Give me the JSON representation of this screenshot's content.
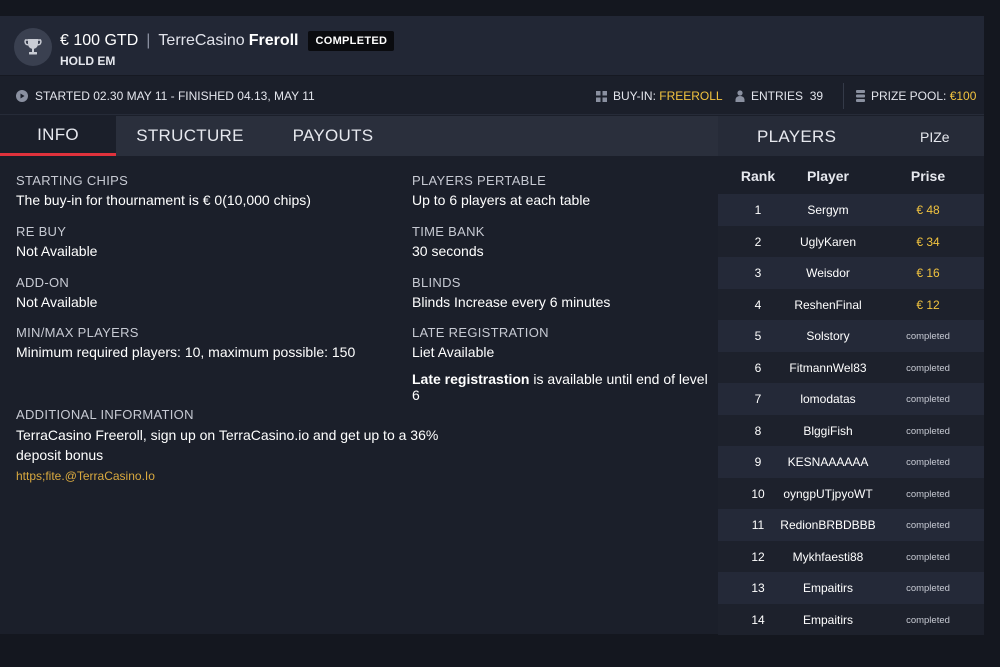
{
  "header": {
    "gtd": "€ 100 GTD",
    "separator": "|",
    "brand": "TerreCasino",
    "name": "Freroll",
    "status": "COMPLETED",
    "game": "HOLD EM"
  },
  "infobar": {
    "started": "STARTED 02.30  MAY 11 - FINISHED 04.13, MAY 11",
    "buyin_label": "BUY-IN:",
    "buyin_value": "FREEROLL",
    "entries_label": "ENTRIES",
    "entries_value": "39",
    "prize_label": "PRIZE POOL:",
    "prize_value": "€100"
  },
  "tabs": [
    {
      "label": "INFO",
      "active": true
    },
    {
      "label": "STRUCTURE",
      "active": false
    },
    {
      "label": "PAYOUTS",
      "active": false
    }
  ],
  "info": {
    "starting_chips_label": "STARTING CHIPS",
    "starting_chips_value": "The buy-in for thournament is € 0(10,000 chips)",
    "rebuy_label": "RE BUY",
    "rebuy_value": "Not Available",
    "addon_label": "ADD-ON",
    "addon_value": "Not Available",
    "minmax_label": "MIN/MAX PLAYERS",
    "minmax_value": "Minimum required players: 10, maximum possible: 150",
    "pertable_label": "PLAYERS PERTABLE",
    "pertable_value": "Up to 6 players at each table",
    "timebank_label": "TIME BANK",
    "timebank_value": "30 seconds",
    "blinds_label": "BLINDS",
    "blinds_value": "Blinds Increase every 6 minutes",
    "latereg_label": "LATE REGISTRATION",
    "latereg_value": "Liet Available",
    "latereg_note_strong": "Late registrastion",
    "latereg_note_rest": " is available until end of level 6",
    "additional_label": "ADDITIONAL INFORMATION",
    "additional_value": "TerraCasino Freeroll, sign up on TerraCasino.io and get up to a 36% deposit bonus",
    "additional_link": "https;fite.@TerraCasino.Io"
  },
  "players": {
    "title": "PLAYERS",
    "pize": "PIZe",
    "headers": {
      "rank": "Rank",
      "player": "Player",
      "prize": "Prise"
    },
    "rows": [
      {
        "rank": "1",
        "player": "Sergym",
        "prize": "€ 48",
        "kind": "gold"
      },
      {
        "rank": "2",
        "player": "UglyKaren",
        "prize": "€ 34",
        "kind": "gold"
      },
      {
        "rank": "3",
        "player": "Weisdor",
        "prize": "€ 16",
        "kind": "gold"
      },
      {
        "rank": "4",
        "player": "ReshenFinal",
        "prize": "€ 12",
        "kind": "gold"
      },
      {
        "rank": "5",
        "player": "Solstory",
        "prize": "completed",
        "kind": "done"
      },
      {
        "rank": "6",
        "player": "FitmannWel83",
        "prize": "completed",
        "kind": "done"
      },
      {
        "rank": "7",
        "player": "lomodatas",
        "prize": "completed",
        "kind": "done"
      },
      {
        "rank": "8",
        "player": "BlggiFish",
        "prize": "completed",
        "kind": "done"
      },
      {
        "rank": "9",
        "player": "KESNAAAAAA",
        "prize": "completed",
        "kind": "done"
      },
      {
        "rank": "10",
        "player": "oyngpUTjpyoWT",
        "prize": "completed",
        "kind": "done"
      },
      {
        "rank": "11",
        "player": "RedionBRBDBBB",
        "prize": "completed",
        "kind": "done"
      },
      {
        "rank": "12",
        "player": "Mykhfaesti88",
        "prize": "completed",
        "kind": "done"
      },
      {
        "rank": "13",
        "player": "Empaitirs",
        "prize": "completed",
        "kind": "done"
      },
      {
        "rank": "14",
        "player": "Empaitirs",
        "prize": "completed",
        "kind": "done"
      }
    ]
  },
  "colors": {
    "accent_red": "#e0323c",
    "gold": "#f1c33f"
  },
  "icons": [
    "trophy-icon",
    "play-circle-icon",
    "grid-icon",
    "person-icon",
    "coins-icon"
  ]
}
